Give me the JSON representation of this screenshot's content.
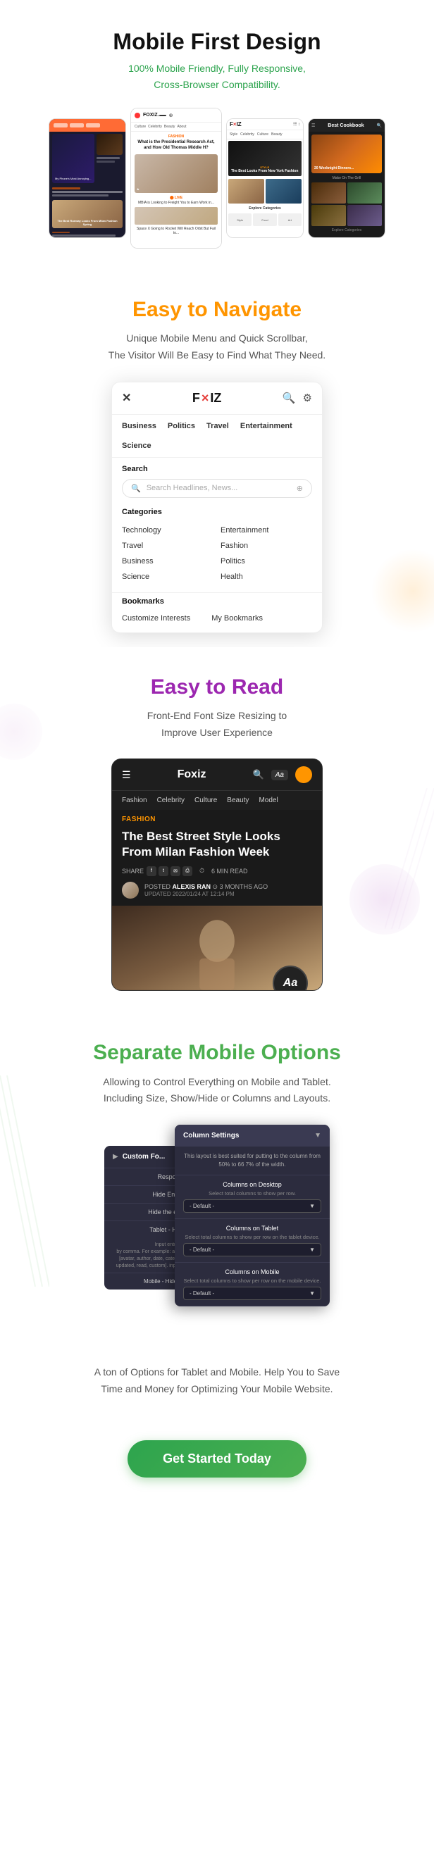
{
  "section1": {
    "title": "Mobile First Design",
    "subtitle": "100% Mobile Friendly, Fully Responsive,\nCross-Browser Compatibility."
  },
  "section2": {
    "title": "Easy to Navigate",
    "description": "Unique Mobile Menu and Quick Scrollbar,\nThe Visitor Will Be Easy to Find What They Need.",
    "nav_mockup": {
      "logo": "F×IZ",
      "menu_items": [
        "Business",
        "Politics",
        "Travel",
        "Entertainment",
        "Science"
      ],
      "search_label": "Search",
      "search_placeholder": "Search Headlines, News...",
      "categories_label": "Categories",
      "categories": [
        "Technology",
        "Entertainment",
        "Travel",
        "Fashion",
        "Business",
        "Politics",
        "Science",
        "Health"
      ],
      "bookmarks_label": "Bookmarks",
      "bookmark_items": [
        "Customize Interests",
        "My Bookmarks"
      ]
    }
  },
  "section3": {
    "title": "Easy to Read",
    "description": "Front-End Font Size Resizing to\nImprove User Experience",
    "article": {
      "logo": "Foxiz",
      "nav_items": [
        "Fashion",
        "Celebrity",
        "Culture",
        "Beauty",
        "Model"
      ],
      "category": "FASHION",
      "title": "The Best Street Style Looks From Milan Fashion Week",
      "share_label": "SHARE",
      "read_time": "6 MIN READ",
      "author_label": "POSTED",
      "author_name": "ALEXIS RAN",
      "time_ago": "3 MONTHS AGO",
      "updated": "UPDATED 2022/01/24 AT 12:14 PM",
      "font_badge": "Aa"
    }
  },
  "section4": {
    "title": "Separate Mobile Options",
    "description": "Allowing to Control Everything on Mobile and Tablet.\nIncluding Size, Show/Hide or Columns and Layouts.",
    "settings": {
      "back_panel_title": "Custom Fo...",
      "back_items": [
        {
          "label": "Responsiv...",
          "sub": ""
        },
        {
          "label": "Hide Entry Cate",
          "sub": ""
        },
        {
          "label": "Hide the entry co...",
          "sub": ""
        },
        {
          "label": "Tablet - Hide En...",
          "sub": ""
        }
      ],
      "front_title": "Column Settings",
      "front_desc": "This layout is best suited for putting to the column from 50% to 66 7% of the width.",
      "rows": [
        {
          "label": "Columns on Desktop",
          "sublabel": "Select total columns to show per row.",
          "value": "- Default -"
        },
        {
          "label": "Columns on Tablet",
          "sublabel": "Select total columns to show per row on the tablet device.",
          "value": "- Default -"
        },
        {
          "label": "Columns on Mobile",
          "sublabel": "Select total columns to show per row on the mobile device.",
          "value": "- Default -"
        }
      ]
    },
    "bottom_text": "A ton of Options for Tablet and Mobile. Help You to Save\nTime and Money for Optimizing Your Mobile Website."
  },
  "cta": {
    "label": "Get Started Today"
  }
}
